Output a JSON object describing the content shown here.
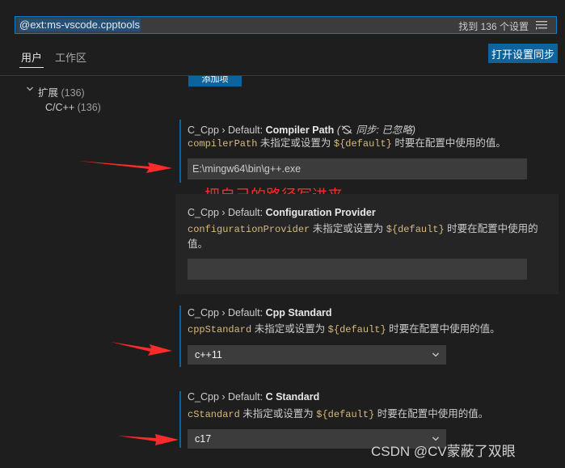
{
  "search": {
    "query": "@ext:ms-vscode.cpptools",
    "placeholder": "",
    "result_count": "找到 136 个设置"
  },
  "tabs": {
    "user": "用户",
    "workspace": "工作区"
  },
  "sync_button": "打开设置同步",
  "tree": {
    "group_label": "扩展",
    "group_count": "(136)",
    "item_label": "C/C++",
    "item_count": "(136)"
  },
  "partial_button": "添加项",
  "settings": {
    "compiler_path": {
      "prefix": "C_Cpp › Default: ",
      "name": "Compiler Path",
      "sync_note": "同步: 已忽略",
      "key": "compilerPath",
      "desc_mid": " 未指定或设置为 ",
      "default_token": "${default}",
      "desc_end": " 时要在配置中使用的值。",
      "value": "E:\\mingw64\\bin\\g++.exe"
    },
    "configuration_provider": {
      "prefix": "C_Cpp › Default: ",
      "name": "Configuration Provider",
      "key": "configurationProvider",
      "desc_mid": " 未指定或设置为 ",
      "default_token": "${default}",
      "desc_end": " 时要在配置中使用的值。",
      "value": ""
    },
    "cpp_standard": {
      "prefix": "C_Cpp › Default: ",
      "name": "Cpp Standard",
      "key": "cppStandard",
      "desc_mid": " 未指定或设置为 ",
      "default_token": "${default}",
      "desc_end": " 时要在配置中使用的值。",
      "value": "c++11"
    },
    "c_standard": {
      "prefix": "C_Cpp › Default: ",
      "name": "C Standard",
      "key": "cStandard",
      "desc_mid": " 未指定或设置为 ",
      "default_token": "${default}",
      "desc_end": " 时要在配置中使用的值。",
      "value": "c17"
    }
  },
  "annotation": "把自己的路径写进来",
  "watermark": "CSDN @CV蒙蔽了双眼",
  "colors": {
    "accent": "#0e639c",
    "annotation_red": "#ff2a2a"
  }
}
